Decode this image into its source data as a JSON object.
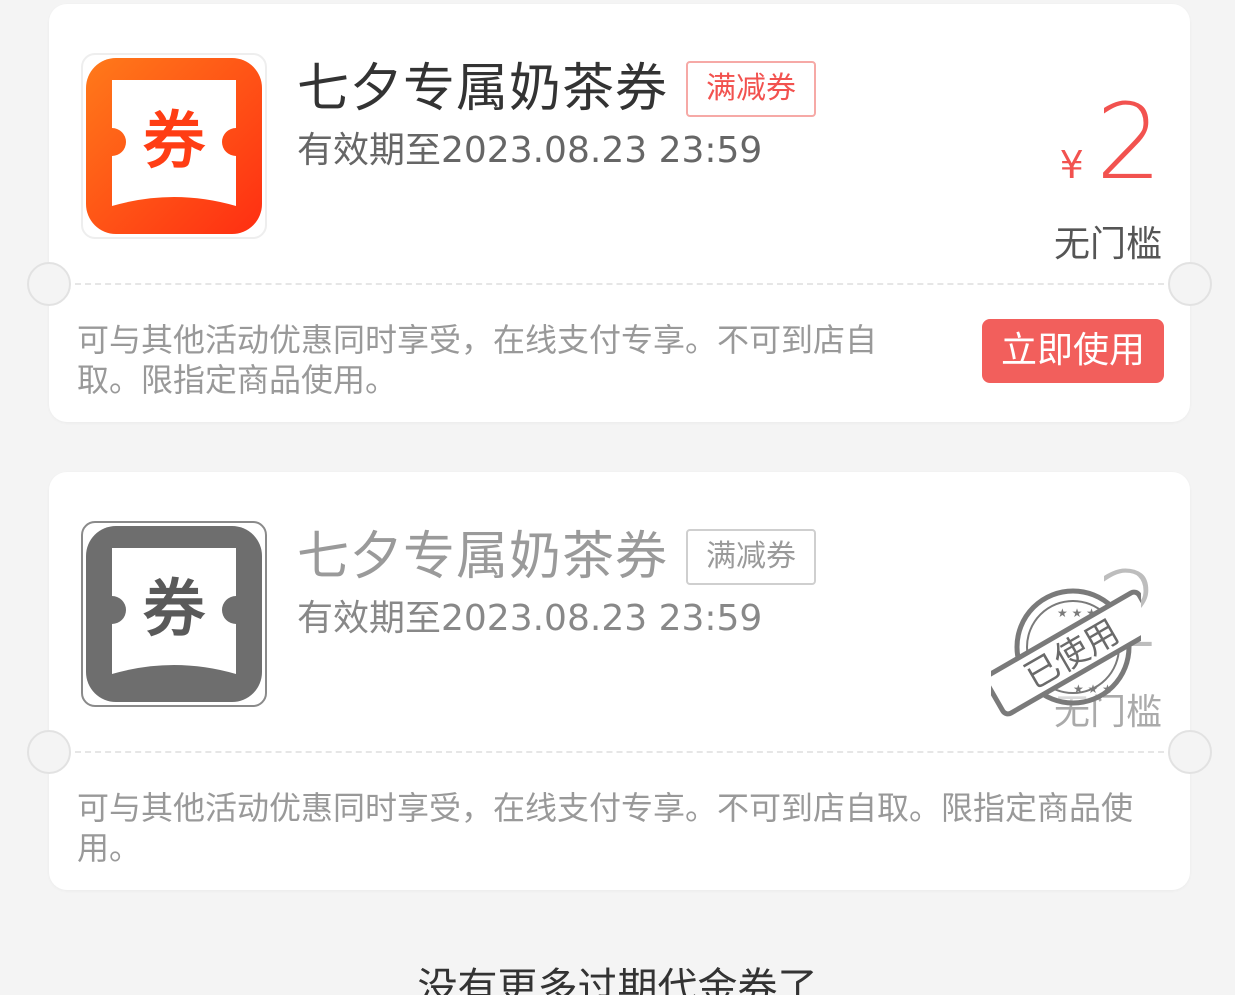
{
  "coupons": [
    {
      "icon": "coupon-icon",
      "icon_char": "券",
      "title": "七夕专属奶茶券",
      "tag": "满减券",
      "expiry": "有效期至2023.08.23 23:59",
      "currency": "¥",
      "amount": "2",
      "threshold": "无门槛",
      "description": "可与其他活动优惠同时享受，在线支付专享。不可到店自取。限指定商品使用。",
      "button_label": "立即使用",
      "status": "active",
      "accent_color": "#f2524f"
    },
    {
      "icon": "coupon-icon",
      "icon_char": "券",
      "title": "七夕专属奶茶券",
      "tag": "满减券",
      "expiry": "有效期至2023.08.23 23:59",
      "amount": "2",
      "threshold": "无门槛",
      "description": "可与其他活动优惠同时享受，在线支付专享。不可到店自取。限指定商品使用。",
      "status": "used",
      "stamp_text": "已使用",
      "accent_color": "#9a9a9a"
    }
  ],
  "footer": {
    "text": "没有更多过期代金券了"
  }
}
